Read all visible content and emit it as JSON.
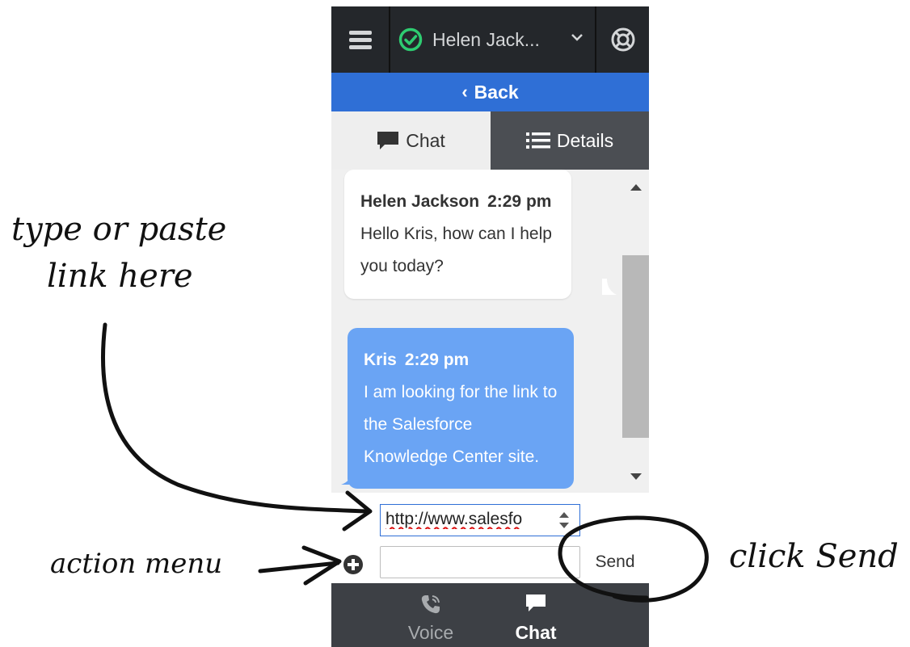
{
  "annotations": {
    "type_or_paste": [
      "type or paste",
      "link here"
    ],
    "action_menu": "action menu",
    "click_send": "click Send"
  },
  "header": {
    "agent_name": "Helen Jack...",
    "status": "ready",
    "status_color": "#2ecc71",
    "icons": [
      "hamburger-menu-icon",
      "status-check-icon",
      "chevron-down-icon",
      "target-icon"
    ]
  },
  "back": {
    "label": "Back"
  },
  "tabs": [
    {
      "label": "Chat",
      "icon": "chat-bubble-icon",
      "active": true
    },
    {
      "label": "Details",
      "icon": "list-icon",
      "active": false
    }
  ],
  "messages": [
    {
      "sender": "Helen Jackson",
      "time": "2:29 pm",
      "text": "Hello Kris, how can I help you today?",
      "side": "left"
    },
    {
      "sender": "Kris",
      "time": "2:29 pm",
      "text": "I am looking for the link to the Salesforce Knowledge Center site.",
      "side": "right"
    }
  ],
  "composer": {
    "url_value": "http://www.salesfo",
    "message_value": "",
    "send_label": "Send"
  },
  "bottom_nav": [
    {
      "label": "Voice",
      "icon": "phone-icon",
      "active": false
    },
    {
      "label": "Chat",
      "icon": "chat-icon",
      "active": true
    }
  ],
  "colors": {
    "brand_blue": "#2f6fd6",
    "bubble_agent": "#ffffff",
    "bubble_customer": "#6aa4f4",
    "top_bar": "#24272b"
  }
}
